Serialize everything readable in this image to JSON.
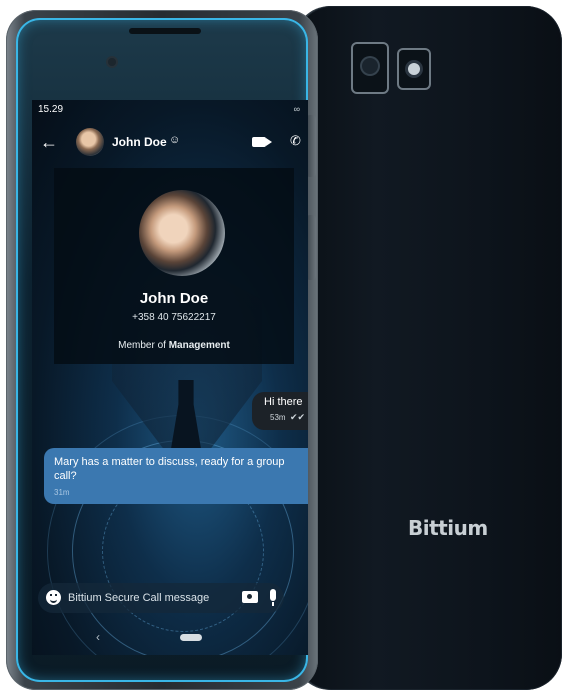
{
  "status_bar": {
    "time": "15.29",
    "icon": "link-icon"
  },
  "header": {
    "contact_name": "John Doe",
    "verified_symbol": "☺",
    "call_symbol": "✆"
  },
  "contact_card": {
    "name": "John Doe",
    "phone": "+358 40 75622217",
    "member_prefix": "Member of",
    "group": "Management"
  },
  "messages": [
    {
      "direction": "outgoing",
      "text": "Hi there",
      "time": "53m",
      "status_symbol": "✔✔"
    },
    {
      "direction": "incoming",
      "text": "Mary has a matter to discuss, ready for a group call?",
      "time": "31m"
    }
  ],
  "composer": {
    "placeholder": "Bittium Secure Call message"
  },
  "nav": {
    "back_symbol": "‹"
  },
  "back_phone": {
    "brand": "Bittium"
  },
  "colors": {
    "accent_glow": "#3ab6e6",
    "incoming_bubble": "#3b78b0",
    "outgoing_bubble": "#1c2228",
    "phone_body": "#0d141c"
  }
}
